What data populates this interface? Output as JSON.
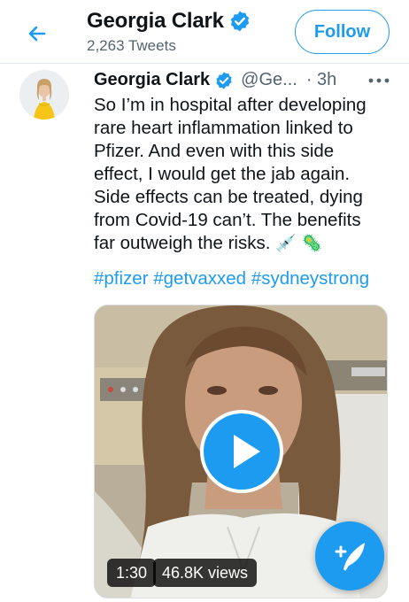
{
  "header": {
    "name": "Georgia Clark",
    "tweet_count": "2,263 Tweets",
    "follow_label": "Follow"
  },
  "tweet": {
    "author_name": "Georgia Clark",
    "handle": "@Ge...",
    "time": "· 3h",
    "text": "So I’m in hospital after developing\nrare heart inflammation linked to\nPfizer. And even with this side\neffect, I would get the jab again.\nSide effects can be treated, dying\nfrom Covid-19 can’t. The benefits\nfar outweigh the risks.",
    "emojis": [
      "💉",
      "🦠"
    ],
    "hashtags": [
      "#pfizer",
      "#getvaxxed",
      "#sydneystrong"
    ]
  },
  "video": {
    "duration": "1:30",
    "views": "46.8K views"
  },
  "icons": {
    "back": "back-arrow-icon",
    "verified": "verified-badge-icon",
    "more": "more-options-icon",
    "play": "play-icon",
    "compose": "compose-tweet-icon"
  },
  "colors": {
    "accent": "#1d9bf0",
    "text": "#0f1419",
    "secondary_text": "#536471"
  }
}
